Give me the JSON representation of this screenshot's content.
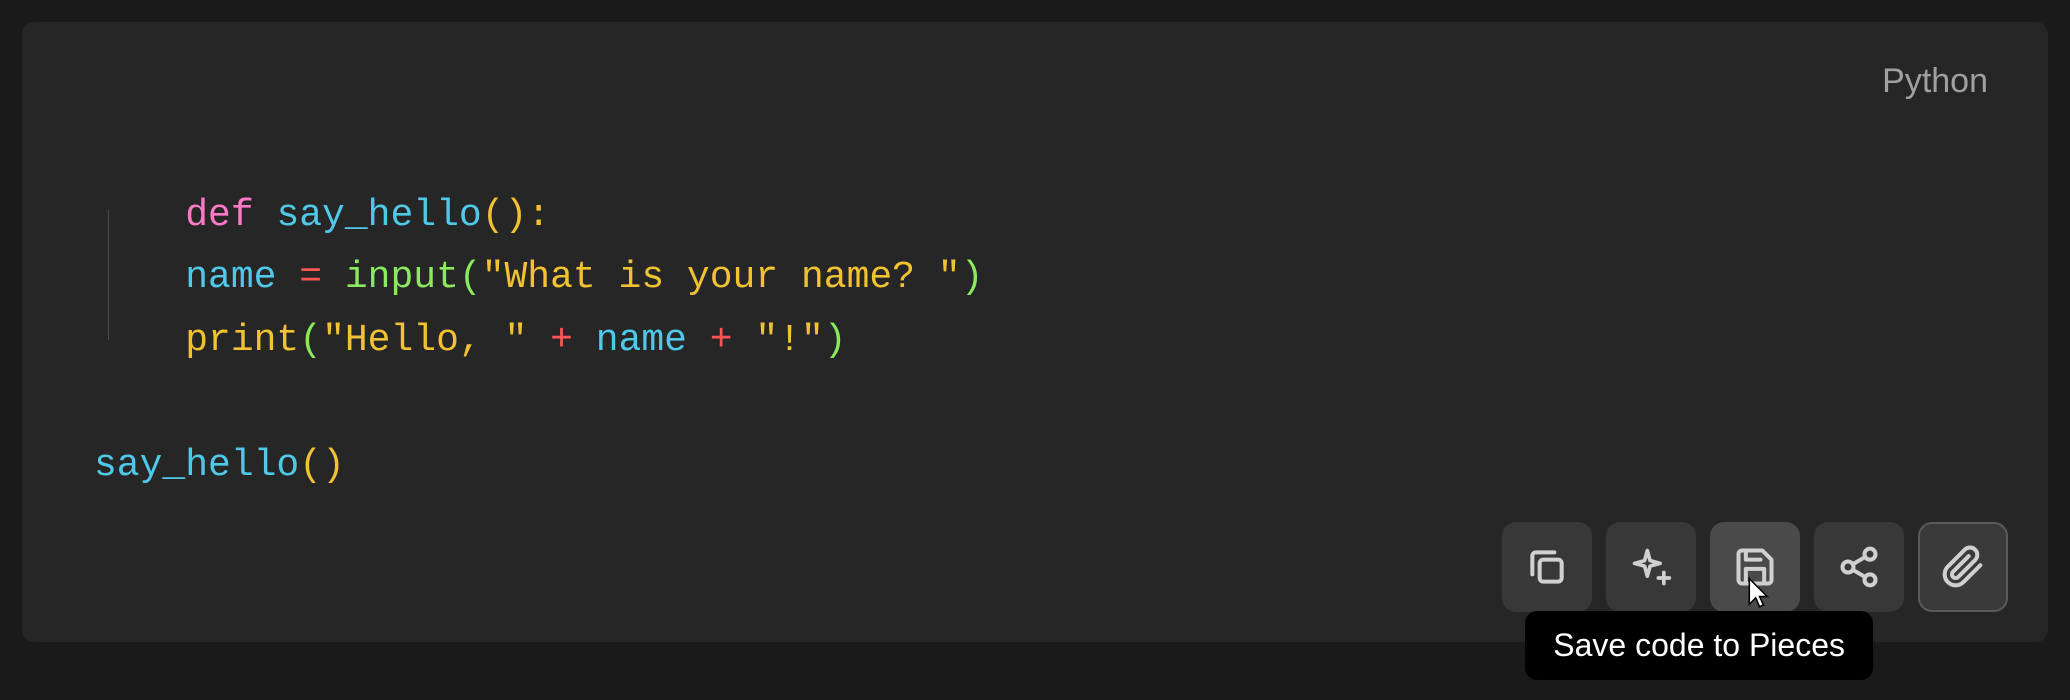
{
  "language_label": "Python",
  "code": {
    "line1": {
      "def": "def",
      "fn": "say_hello",
      "parens": "():"
    },
    "line2": {
      "indent": "    ",
      "var": "name",
      "eq": " = ",
      "builtin": "input",
      "open": "(",
      "str": "\"What is your name? \"",
      "close": ")"
    },
    "line3": {
      "indent": "    ",
      "builtin": "print",
      "open": "(",
      "str1": "\"Hello, \"",
      "plus1": " + ",
      "var": "name",
      "plus2": " + ",
      "str2": "\"!\"",
      "close": ")"
    },
    "line5": {
      "fn": "say_hello",
      "parens": "()"
    }
  },
  "tooltip": "Save code to Pieces",
  "icons": {
    "copy": "copy",
    "sparkle": "sparkle",
    "save": "save",
    "share": "share",
    "attach": "attach"
  }
}
